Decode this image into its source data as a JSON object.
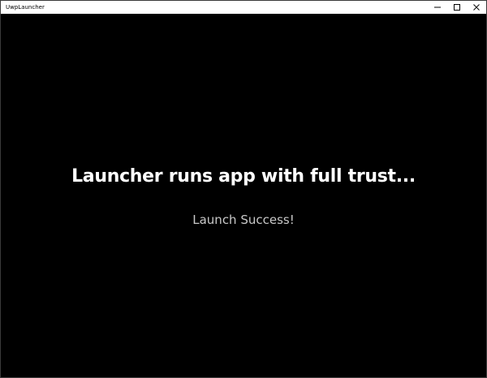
{
  "window": {
    "title": "UwpLauncher"
  },
  "caption_buttons": {
    "minimize_icon": "minimize-icon",
    "maximize_icon": "maximize-icon",
    "close_icon": "close-icon"
  },
  "main": {
    "headline": "Launcher runs app with full trust...",
    "status": "Launch Success!"
  },
  "colors": {
    "background": "#000000",
    "titlebar": "#ffffff",
    "headline": "#ffffff",
    "status": "#c8c8c8"
  }
}
